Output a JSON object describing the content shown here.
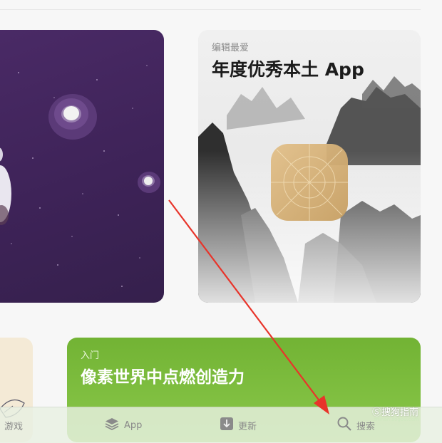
{
  "cards": {
    "favorite": {
      "kicker": "编辑最爱",
      "title": "年度优秀本土 App"
    },
    "getting_started": {
      "kicker": "入门",
      "title": "像素世界中点燃创造力"
    }
  },
  "tabbar": {
    "items": [
      {
        "label": "游戏",
        "icon": "rocket-icon"
      },
      {
        "label": "App",
        "icon": "layers-icon"
      },
      {
        "label": "更新",
        "icon": "download-icon"
      },
      {
        "label": "搜索",
        "icon": "search-icon"
      }
    ]
  },
  "watermark": {
    "text": "搜狗指南",
    "url": "zhinan.sogou.com"
  },
  "colors": {
    "arrow": "#e8342a",
    "green_card": "#7dbd3e",
    "space_card": "#44285f"
  }
}
